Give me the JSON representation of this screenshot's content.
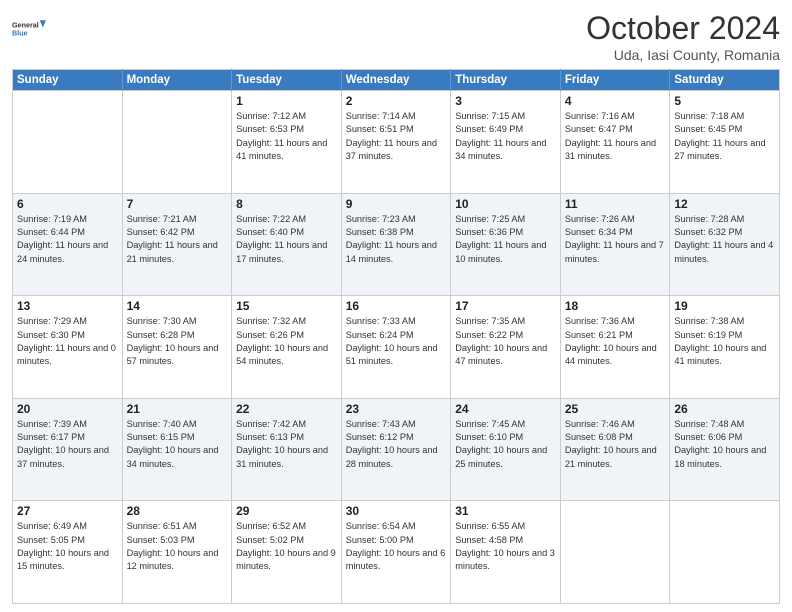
{
  "logo": {
    "general": "General",
    "blue": "Blue"
  },
  "header": {
    "title": "October 2024",
    "subtitle": "Uda, Iasi County, Romania"
  },
  "weekdays": [
    "Sunday",
    "Monday",
    "Tuesday",
    "Wednesday",
    "Thursday",
    "Friday",
    "Saturday"
  ],
  "weeks": [
    [
      {
        "day": "",
        "info": ""
      },
      {
        "day": "",
        "info": ""
      },
      {
        "day": "1",
        "info": "Sunrise: 7:12 AM\nSunset: 6:53 PM\nDaylight: 11 hours and 41 minutes."
      },
      {
        "day": "2",
        "info": "Sunrise: 7:14 AM\nSunset: 6:51 PM\nDaylight: 11 hours and 37 minutes."
      },
      {
        "day": "3",
        "info": "Sunrise: 7:15 AM\nSunset: 6:49 PM\nDaylight: 11 hours and 34 minutes."
      },
      {
        "day": "4",
        "info": "Sunrise: 7:16 AM\nSunset: 6:47 PM\nDaylight: 11 hours and 31 minutes."
      },
      {
        "day": "5",
        "info": "Sunrise: 7:18 AM\nSunset: 6:45 PM\nDaylight: 11 hours and 27 minutes."
      }
    ],
    [
      {
        "day": "6",
        "info": "Sunrise: 7:19 AM\nSunset: 6:44 PM\nDaylight: 11 hours and 24 minutes."
      },
      {
        "day": "7",
        "info": "Sunrise: 7:21 AM\nSunset: 6:42 PM\nDaylight: 11 hours and 21 minutes."
      },
      {
        "day": "8",
        "info": "Sunrise: 7:22 AM\nSunset: 6:40 PM\nDaylight: 11 hours and 17 minutes."
      },
      {
        "day": "9",
        "info": "Sunrise: 7:23 AM\nSunset: 6:38 PM\nDaylight: 11 hours and 14 minutes."
      },
      {
        "day": "10",
        "info": "Sunrise: 7:25 AM\nSunset: 6:36 PM\nDaylight: 11 hours and 10 minutes."
      },
      {
        "day": "11",
        "info": "Sunrise: 7:26 AM\nSunset: 6:34 PM\nDaylight: 11 hours and 7 minutes."
      },
      {
        "day": "12",
        "info": "Sunrise: 7:28 AM\nSunset: 6:32 PM\nDaylight: 11 hours and 4 minutes."
      }
    ],
    [
      {
        "day": "13",
        "info": "Sunrise: 7:29 AM\nSunset: 6:30 PM\nDaylight: 11 hours and 0 minutes."
      },
      {
        "day": "14",
        "info": "Sunrise: 7:30 AM\nSunset: 6:28 PM\nDaylight: 10 hours and 57 minutes."
      },
      {
        "day": "15",
        "info": "Sunrise: 7:32 AM\nSunset: 6:26 PM\nDaylight: 10 hours and 54 minutes."
      },
      {
        "day": "16",
        "info": "Sunrise: 7:33 AM\nSunset: 6:24 PM\nDaylight: 10 hours and 51 minutes."
      },
      {
        "day": "17",
        "info": "Sunrise: 7:35 AM\nSunset: 6:22 PM\nDaylight: 10 hours and 47 minutes."
      },
      {
        "day": "18",
        "info": "Sunrise: 7:36 AM\nSunset: 6:21 PM\nDaylight: 10 hours and 44 minutes."
      },
      {
        "day": "19",
        "info": "Sunrise: 7:38 AM\nSunset: 6:19 PM\nDaylight: 10 hours and 41 minutes."
      }
    ],
    [
      {
        "day": "20",
        "info": "Sunrise: 7:39 AM\nSunset: 6:17 PM\nDaylight: 10 hours and 37 minutes."
      },
      {
        "day": "21",
        "info": "Sunrise: 7:40 AM\nSunset: 6:15 PM\nDaylight: 10 hours and 34 minutes."
      },
      {
        "day": "22",
        "info": "Sunrise: 7:42 AM\nSunset: 6:13 PM\nDaylight: 10 hours and 31 minutes."
      },
      {
        "day": "23",
        "info": "Sunrise: 7:43 AM\nSunset: 6:12 PM\nDaylight: 10 hours and 28 minutes."
      },
      {
        "day": "24",
        "info": "Sunrise: 7:45 AM\nSunset: 6:10 PM\nDaylight: 10 hours and 25 minutes."
      },
      {
        "day": "25",
        "info": "Sunrise: 7:46 AM\nSunset: 6:08 PM\nDaylight: 10 hours and 21 minutes."
      },
      {
        "day": "26",
        "info": "Sunrise: 7:48 AM\nSunset: 6:06 PM\nDaylight: 10 hours and 18 minutes."
      }
    ],
    [
      {
        "day": "27",
        "info": "Sunrise: 6:49 AM\nSunset: 5:05 PM\nDaylight: 10 hours and 15 minutes."
      },
      {
        "day": "28",
        "info": "Sunrise: 6:51 AM\nSunset: 5:03 PM\nDaylight: 10 hours and 12 minutes."
      },
      {
        "day": "29",
        "info": "Sunrise: 6:52 AM\nSunset: 5:02 PM\nDaylight: 10 hours and 9 minutes."
      },
      {
        "day": "30",
        "info": "Sunrise: 6:54 AM\nSunset: 5:00 PM\nDaylight: 10 hours and 6 minutes."
      },
      {
        "day": "31",
        "info": "Sunrise: 6:55 AM\nSunset: 4:58 PM\nDaylight: 10 hours and 3 minutes."
      },
      {
        "day": "",
        "info": ""
      },
      {
        "day": "",
        "info": ""
      }
    ]
  ]
}
